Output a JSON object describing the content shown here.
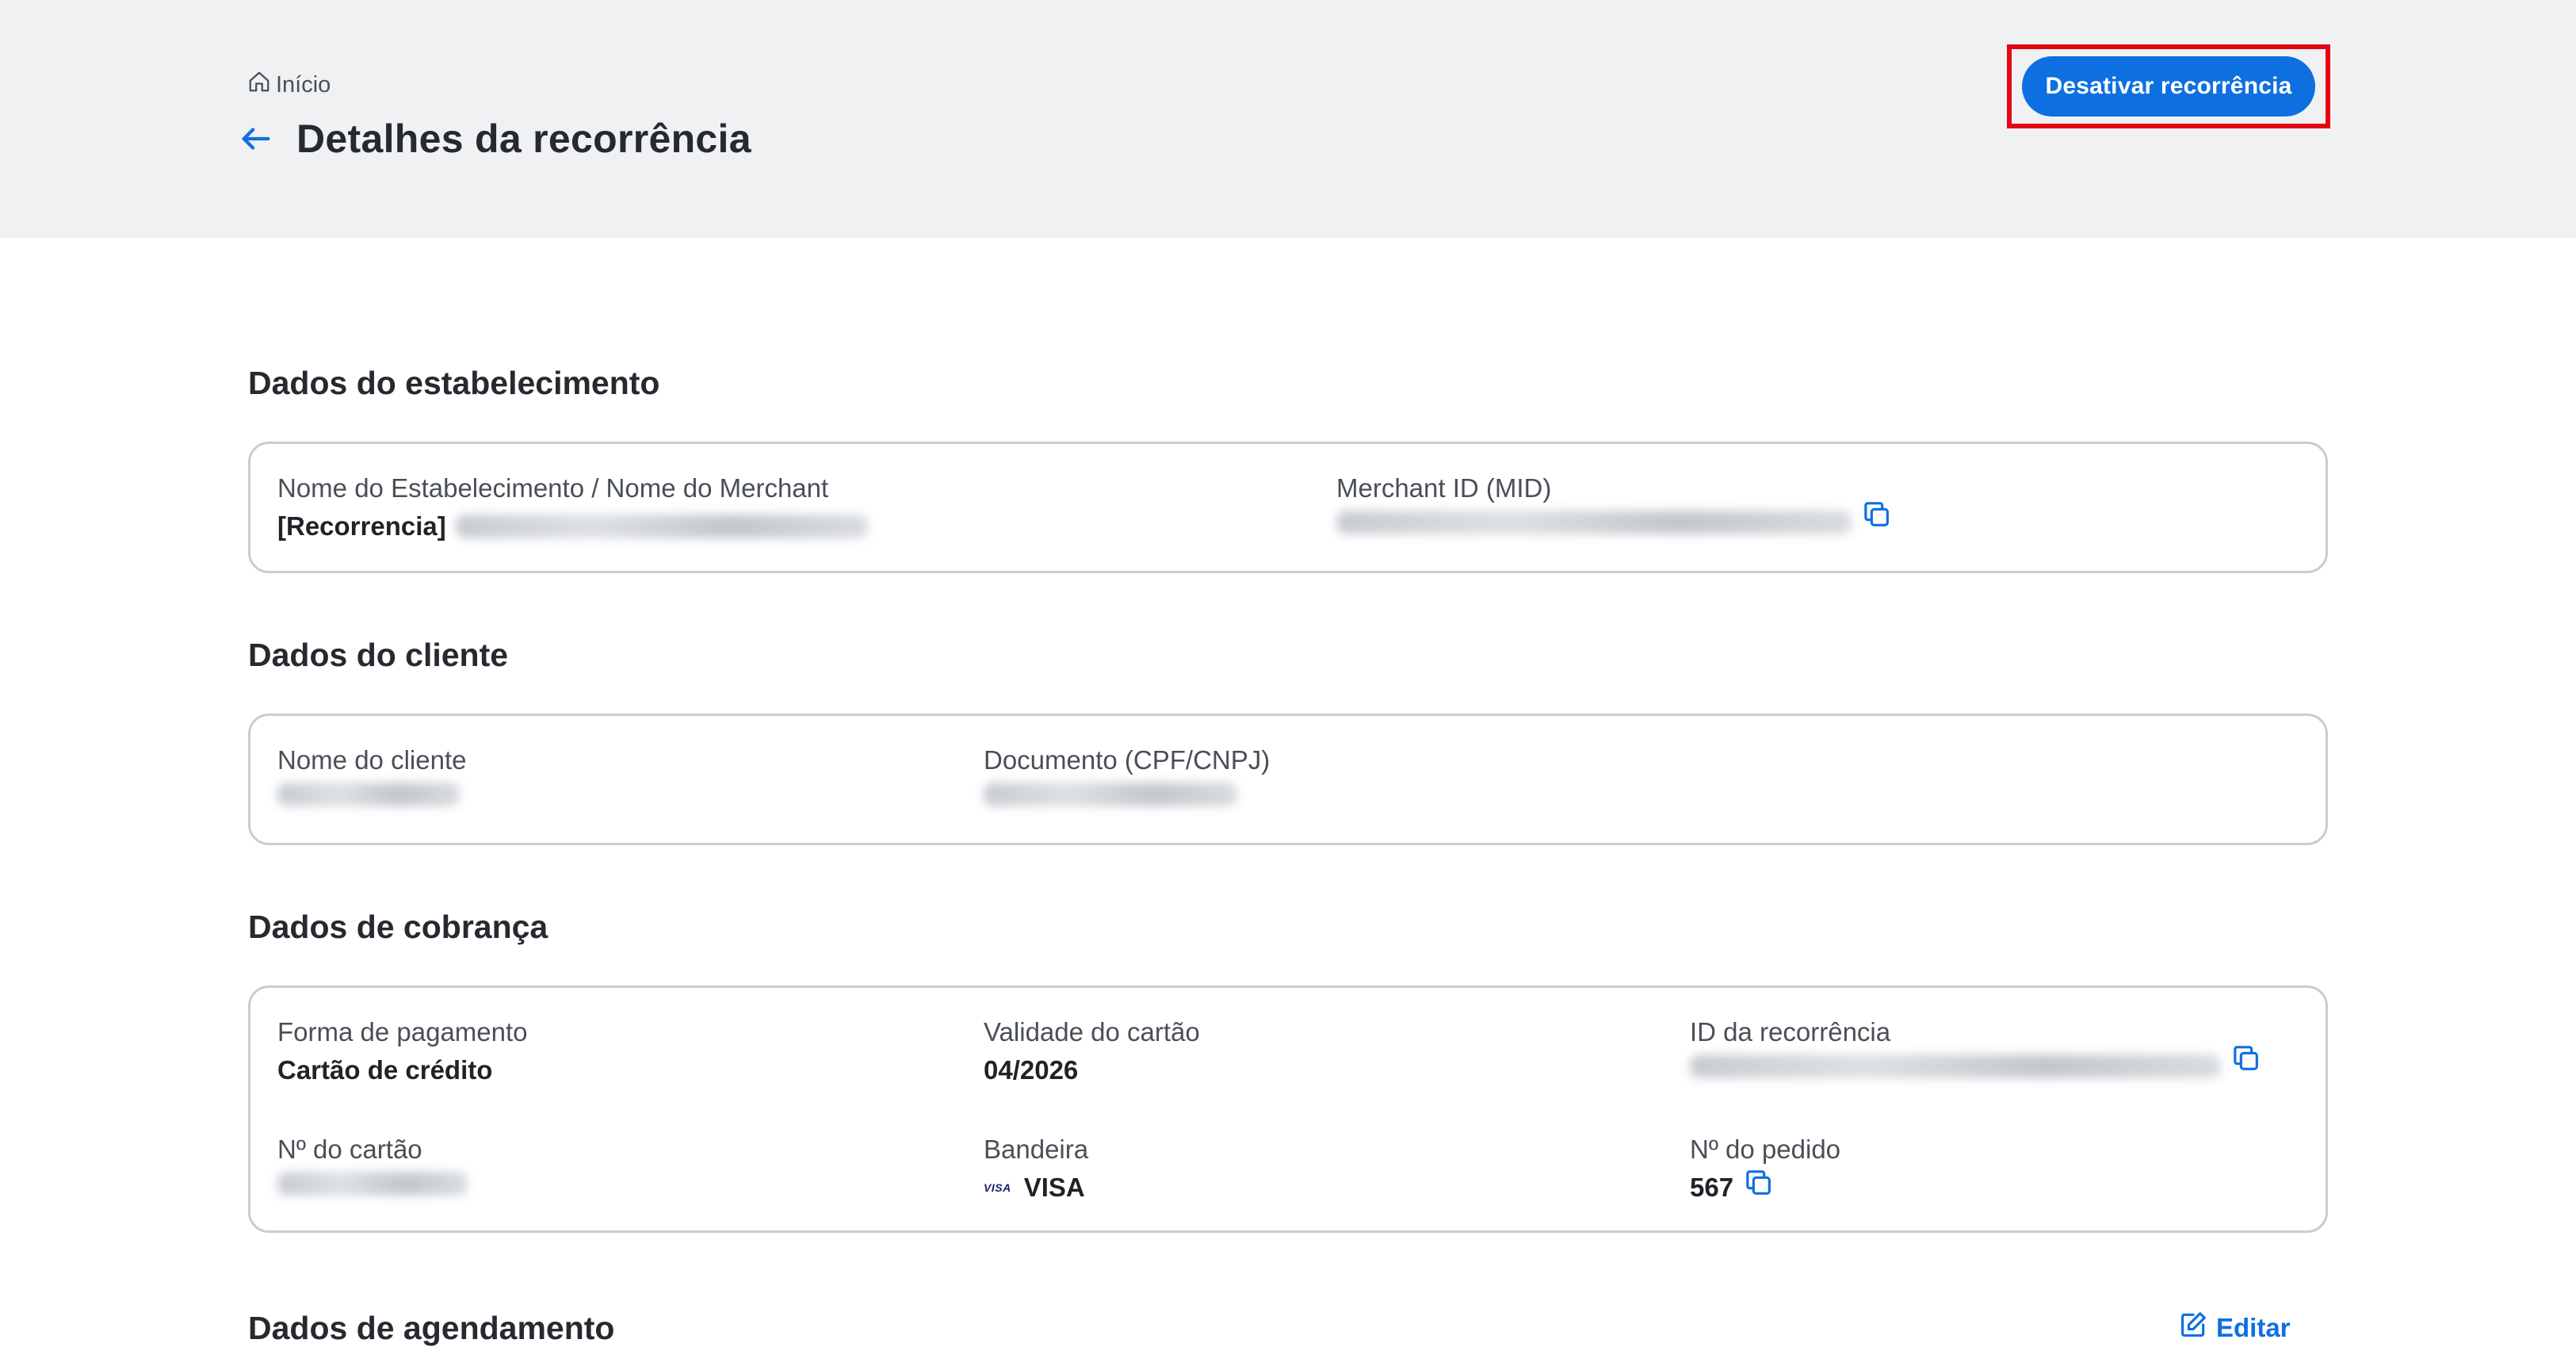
{
  "header": {
    "breadcrumb_home": "Início",
    "title": "Detalhes da recorrência",
    "deactivate_button": "Desativar recorrência"
  },
  "establishment": {
    "section_title": "Dados do estabelecimento",
    "name_label": "Nome do Estabelecimento / Nome do Merchant",
    "name_value_prefix": "[Recorrencia]",
    "mid_label": "Merchant ID (MID)"
  },
  "client": {
    "section_title": "Dados do cliente",
    "name_label": "Nome do cliente",
    "document_label": "Documento (CPF/CNPJ)"
  },
  "billing": {
    "section_title": "Dados de cobrança",
    "payment_method_label": "Forma de pagamento",
    "payment_method_value": "Cartão de crédito",
    "card_validity_label": "Validade do cartão",
    "card_validity_value": "04/2026",
    "recurrence_id_label": "ID da recorrência",
    "card_number_label": "Nº do cartão",
    "brand_label": "Bandeira",
    "brand_logo_text": "VISA",
    "brand_value": "VISA",
    "order_number_label": "Nº do pedido",
    "order_number_value": "567"
  },
  "scheduling": {
    "section_title": "Dados de agendamento",
    "edit_link": "Editar"
  },
  "icons": {
    "home": "home-icon",
    "back": "arrow-left-icon",
    "copy": "copy-icon",
    "edit": "edit-icon",
    "brand": "visa-logo"
  },
  "colors": {
    "primary": "#0e6fe0",
    "highlight_border": "#e30613",
    "header_bg": "#f0f1f3"
  }
}
